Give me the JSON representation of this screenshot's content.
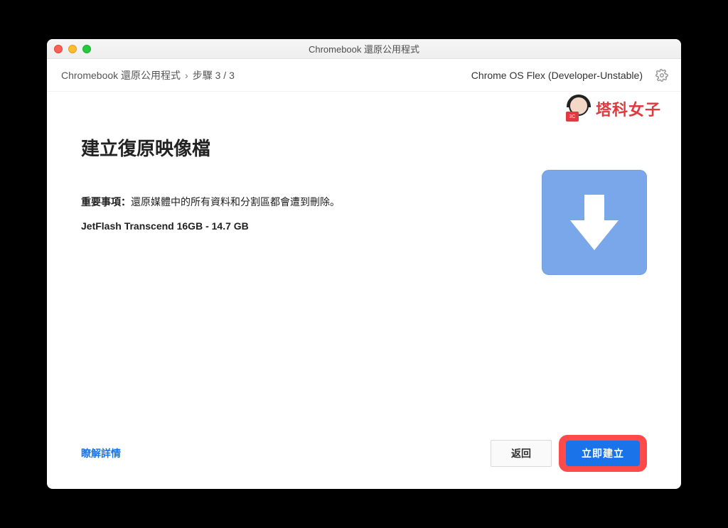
{
  "window": {
    "title": "Chromebook 還原公用程式"
  },
  "header": {
    "app_name": "Chromebook 還原公用程式",
    "separator": "›",
    "step_label": "步驟 3 / 3",
    "model": "Chrome OS Flex (Developer-Unstable)"
  },
  "watermark": {
    "badge": "3C",
    "text": "塔科女子"
  },
  "main": {
    "heading": "建立復原映像檔",
    "important_prefix": "重要事項：",
    "important_text": "還原媒體中的所有資料和分割區都會遭到刪除。",
    "device": "JetFlash Transcend 16GB - 14.7 GB"
  },
  "footer": {
    "learn_more": "瞭解詳情",
    "back": "返回",
    "create": "立即建立"
  }
}
